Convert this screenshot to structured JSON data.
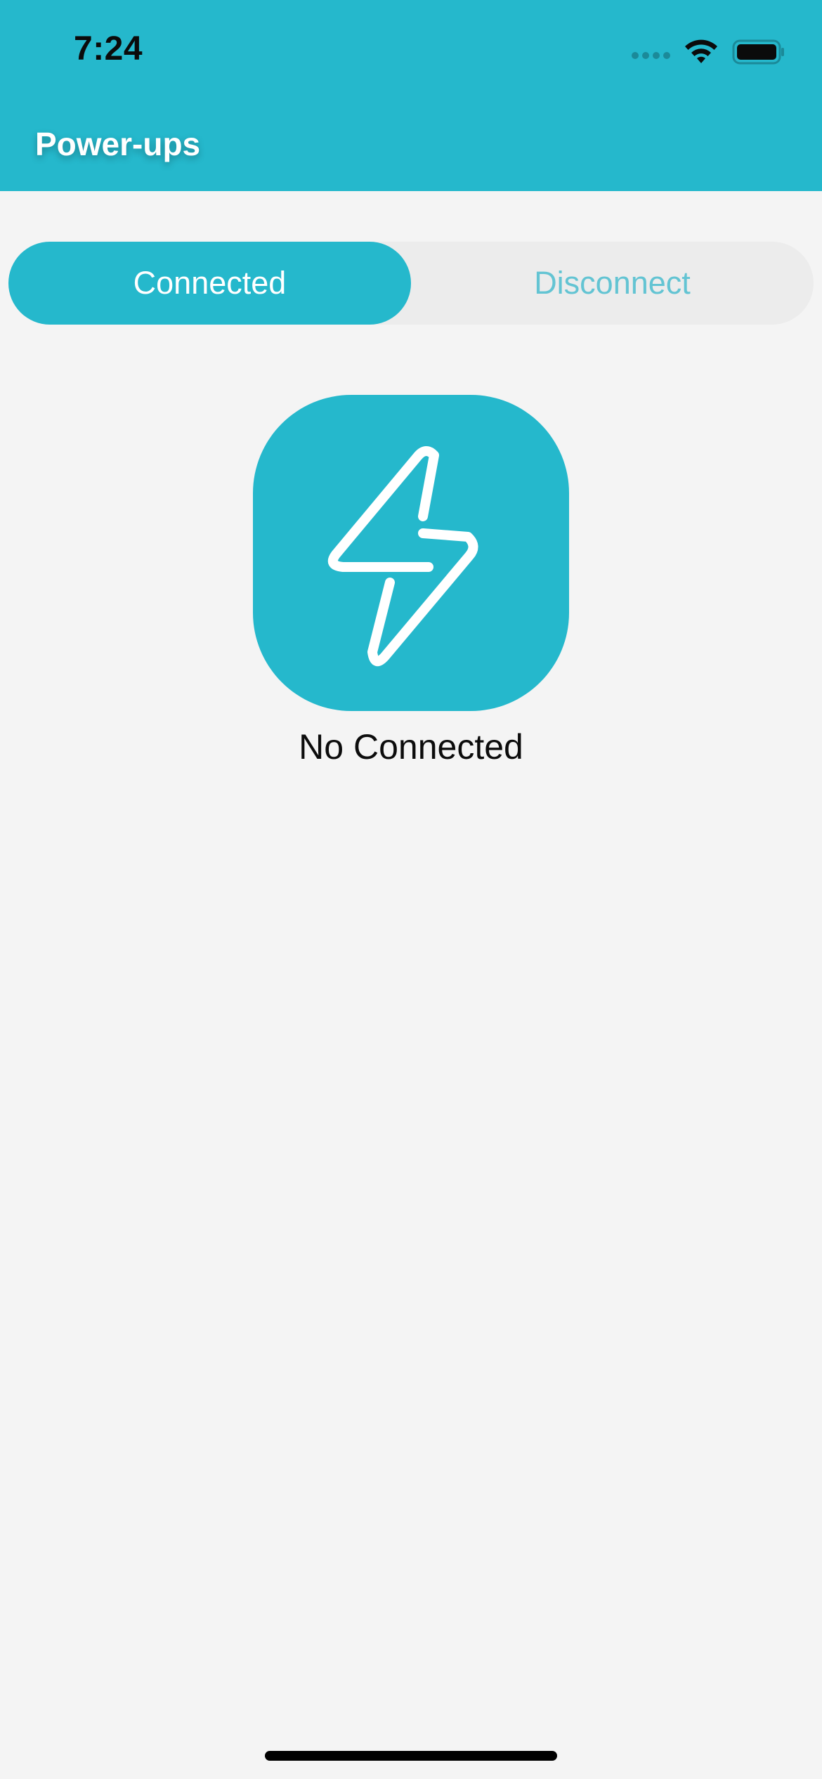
{
  "status_bar": {
    "time": "7:24"
  },
  "header": {
    "title": "Power-ups"
  },
  "segmented_control": {
    "segments": [
      {
        "label": "Connected",
        "selected": true
      },
      {
        "label": "Disconnect",
        "selected": false
      }
    ]
  },
  "empty_state": {
    "icon": "lightning-bolt-icon",
    "message": "No Connected"
  },
  "colors": {
    "accent": "#25b8cc",
    "background": "#f4f4f4",
    "inactive_segment_bg": "#ececec",
    "inactive_segment_text": "#63c4d3"
  }
}
